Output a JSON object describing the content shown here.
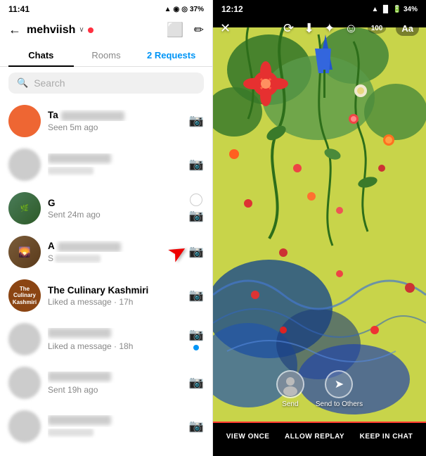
{
  "left": {
    "status": {
      "time": "11:41",
      "icons": "▲ ◉ ⓘ ◎ •••  37%"
    },
    "header": {
      "back_label": "←",
      "username": "mehviish",
      "chevron": "∨",
      "edit_icon": "✎",
      "video_icon": "⬜"
    },
    "tabs": {
      "chats": "Chats",
      "rooms": "Rooms",
      "requests": "2 Requests"
    },
    "search": {
      "placeholder": "Search"
    },
    "chats": [
      {
        "id": 1,
        "name_visible": "Ta",
        "name_blurred": true,
        "status": "Seen 5m ago",
        "has_camera": true,
        "has_circle": false,
        "has_dot": false,
        "avatar_type": "red"
      },
      {
        "id": 2,
        "name_visible": "",
        "name_blurred": true,
        "status_blurred": true,
        "has_camera": true,
        "has_circle": false,
        "has_dot": false,
        "avatar_type": "blur"
      },
      {
        "id": 3,
        "name_visible": "G",
        "name_blurred": false,
        "status": "Sent 24m ago",
        "has_camera": true,
        "has_circle": true,
        "has_dot": false,
        "avatar_type": "nature"
      },
      {
        "id": 4,
        "name_visible": "A",
        "name_blurred": true,
        "status_blurred": true,
        "has_camera": true,
        "has_circle": false,
        "has_dot": false,
        "avatar_type": "blur2",
        "arrow": true
      },
      {
        "id": 5,
        "name_visible": "The Culinary Kashmiri",
        "name_blurred": false,
        "status": "Liked a message · 17h",
        "has_camera": true,
        "has_circle": false,
        "has_dot": false,
        "avatar_type": "culinary"
      },
      {
        "id": 6,
        "name_visible": "",
        "name_blurred": true,
        "status": "Liked a message · 18h",
        "has_camera": true,
        "has_circle": false,
        "has_dot": true,
        "avatar_type": "blur3"
      },
      {
        "id": 7,
        "name_visible": "",
        "name_blurred": true,
        "status": "Sent 19h ago",
        "has_camera": true,
        "has_circle": false,
        "has_dot": false,
        "avatar_type": "blur4"
      },
      {
        "id": 8,
        "name_visible": "",
        "name_blurred": true,
        "status_blurred": true,
        "has_camera": true,
        "has_circle": false,
        "has_dot": false,
        "avatar_type": "blur5"
      }
    ]
  },
  "right": {
    "status": {
      "time": "12:12",
      "battery": "34%"
    },
    "toolbar": {
      "close": "✕",
      "refresh": "↻",
      "download": "↓",
      "sparkle": "✦",
      "emoji": "☺",
      "aa": "Aa"
    },
    "send": {
      "send_label": "Send",
      "others_label": "Send to Others"
    },
    "bottom_actions": {
      "view_once": "VIEW ONCE",
      "allow_replay": "ALLOW REPLAY",
      "keep_in_chat": "KEEP IN CHAT"
    }
  }
}
